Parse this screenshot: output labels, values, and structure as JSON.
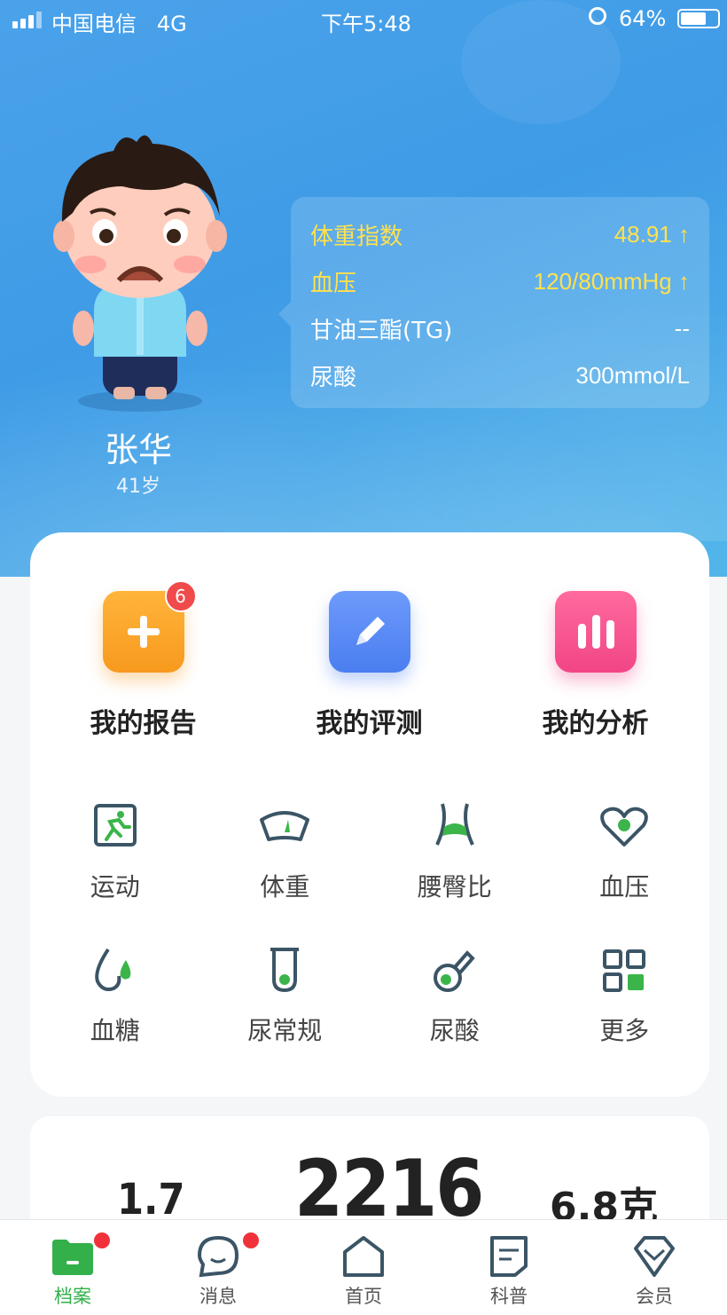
{
  "status_bar": {
    "carrier": "中国电信",
    "network": "4G",
    "time": "下午5:48",
    "battery": "64%"
  },
  "profile": {
    "name": "张华",
    "age": "41岁"
  },
  "metrics": [
    {
      "label": "体重指数",
      "value": "48.91 ↑",
      "warn": true
    },
    {
      "label": "血压",
      "value": "120/80mmHg ↑",
      "warn": true
    },
    {
      "label": "甘油三酯(TG)",
      "value": "--",
      "warn": false
    },
    {
      "label": "尿酸",
      "value": "300mmol/L",
      "warn": false
    }
  ],
  "big_actions": [
    {
      "label": "我的报告",
      "icon": "calendar-plus-icon",
      "badge": "6"
    },
    {
      "label": "我的评测",
      "icon": "pencil-icon"
    },
    {
      "label": "我的分析",
      "icon": "bar-chart-icon"
    }
  ],
  "grid": [
    {
      "label": "运动",
      "icon": "running-icon"
    },
    {
      "label": "体重",
      "icon": "scale-icon"
    },
    {
      "label": "腰臀比",
      "icon": "waist-hip-icon"
    },
    {
      "label": "血压",
      "icon": "heart-icon"
    },
    {
      "label": "血糖",
      "icon": "blood-drop-icon"
    },
    {
      "label": "尿常规",
      "icon": "test-tube-icon"
    },
    {
      "label": "尿酸",
      "icon": "flask-icon"
    },
    {
      "label": "更多",
      "icon": "more-grid-icon"
    }
  ],
  "summary": {
    "left": "1.7",
    "center": "2216",
    "right": "6.8克"
  },
  "tabs": [
    {
      "label": "档案",
      "icon": "folder-icon",
      "active": true,
      "dot": true
    },
    {
      "label": "消息",
      "icon": "chat-bubble-icon",
      "active": false,
      "dot": true
    },
    {
      "label": "首页",
      "icon": "home-icon",
      "active": false,
      "dot": false
    },
    {
      "label": "科普",
      "icon": "article-icon",
      "active": false,
      "dot": false
    },
    {
      "label": "会员",
      "icon": "diamond-icon",
      "active": false,
      "dot": false
    }
  ],
  "colors": {
    "accent_green": "#33b04a",
    "warn_yellow": "#ffe14d",
    "header_blue": "#3f9be6"
  }
}
